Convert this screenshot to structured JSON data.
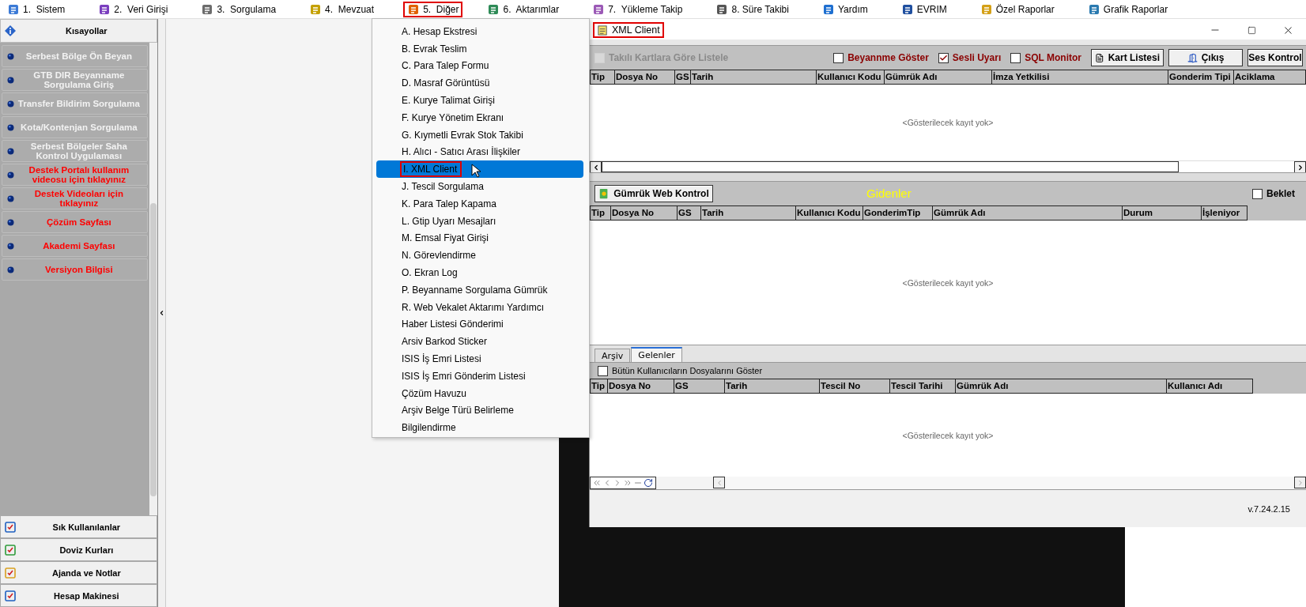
{
  "menu_bar": {
    "items": [
      {
        "label": "1.  Sistem",
        "selected": false
      },
      {
        "label": "2.  Veri Girişi",
        "selected": false
      },
      {
        "label": "3.  Sorgulama",
        "selected": false
      },
      {
        "label": "4.  Mevzuat",
        "selected": false
      },
      {
        "label": "5.  Diğer",
        "selected": true
      },
      {
        "label": "6.  Aktarımlar",
        "selected": false
      },
      {
        "label": "7.  Yükleme Takip",
        "selected": false
      },
      {
        "label": "8. Süre Takibi",
        "selected": false
      },
      {
        "label": "Yardım",
        "selected": false
      },
      {
        "label": "EVRIM",
        "selected": false
      },
      {
        "label": "Özel Raporlar",
        "selected": false
      },
      {
        "label": "Grafik Raporlar",
        "selected": false
      }
    ]
  },
  "sidebar": {
    "header": "Kısayollar",
    "items": [
      {
        "label": "Serbest Bölge Ön Beyan",
        "color": "#f2f2f2"
      },
      {
        "label": "GTB DIR Beyanname Sorgulama Giriş",
        "color": "#f2f2f2"
      },
      {
        "label": "Transfer Bildirim Sorgulama",
        "color": "#f2f2f2"
      },
      {
        "label": "Kota/Kontenjan Sorgulama",
        "color": "#f2f2f2"
      },
      {
        "label": "Serbest Bölgeler Saha Kontrol Uygulaması",
        "color": "#f2f2f2"
      },
      {
        "label": "Destek Portalı kullanım videosu için tıklayınız",
        "color": "#ff0000"
      },
      {
        "label": "Destek Videoları için tıklayınız",
        "color": "#ff0000"
      },
      {
        "label": "Çözüm Sayfası",
        "color": "#ff0000"
      },
      {
        "label": "Akademi Sayfası",
        "color": "#ff0000"
      },
      {
        "label": "Versiyon Bilgisi",
        "color": "#ff0000"
      }
    ],
    "bottom_buttons": [
      "Sık Kullanılanlar",
      "Doviz Kurları",
      "Ajanda ve Notlar",
      "Hesap Makinesi"
    ]
  },
  "dropdown_menu": {
    "items": [
      {
        "label": "A. Hesap Ekstresi",
        "selected": false
      },
      {
        "label": "B. Evrak Teslim",
        "selected": false
      },
      {
        "label": "C. Para Talep Formu",
        "selected": false
      },
      {
        "label": "D. Masraf Görüntüsü",
        "selected": false
      },
      {
        "label": "E. Kurye Talimat Girişi",
        "selected": false
      },
      {
        "label": "F. Kurye Yönetim Ekranı",
        "selected": false
      },
      {
        "label": "G. Kıymetli Evrak Stok Takibi",
        "selected": false
      },
      {
        "label": "H. Alıcı - Satıcı Arası İlişkiler",
        "selected": false
      },
      {
        "label": "I. XML Client",
        "selected": true
      },
      {
        "label": "J. Tescil Sorgulama",
        "selected": false
      },
      {
        "label": "K. Para Talep Kapama",
        "selected": false
      },
      {
        "label": "L. Gtip Uyarı Mesajları",
        "selected": false
      },
      {
        "label": "M. Emsal Fiyat Girişi",
        "selected": false
      },
      {
        "label": "N. Görevlendirme",
        "selected": false
      },
      {
        "label": "O. Ekran Log",
        "selected": false
      },
      {
        "label": "P. Beyanname Sorgulama Gümrük",
        "selected": false
      },
      {
        "label": "R. Web Vekalet Aktarımı Yardımcı",
        "selected": false
      },
      {
        "label": "Haber Listesi Gönderimi",
        "selected": false
      },
      {
        "label": "Arsiv Barkod Sticker",
        "selected": false
      },
      {
        "label": "ISIS İş Emri Listesi",
        "selected": false
      },
      {
        "label": "ISIS İş Emri Gönderim Listesi",
        "selected": false
      },
      {
        "label": "Çözüm Havuzu",
        "selected": false
      },
      {
        "label": "Arşiv Belge Türü Belirleme",
        "selected": false
      },
      {
        "label": "Bilgilendirme",
        "selected": false
      }
    ]
  },
  "window": {
    "title": "XML Client",
    "title_marked": true,
    "toolbar": {
      "checkboxes": [
        {
          "label": "Takılı Kartlara Göre Listele",
          "checked": false,
          "disabled": true
        },
        {
          "label": "Beyannme Göster",
          "checked": false,
          "disabled": false
        },
        {
          "label": "Sesli Uyarı",
          "checked": true,
          "disabled": false
        },
        {
          "label": "SQL Monitor",
          "checked": false,
          "disabled": false
        }
      ],
      "buttons": [
        "Kart Listesi",
        "Çıkış",
        "Ses Kontrol"
      ]
    },
    "top_table": {
      "columns": [
        "Tip",
        "Dosya No",
        "GS",
        "Tarih",
        "Kullanıcı Kodu",
        "Gümrük Adı",
        "İmza Yetkilisi",
        "Gonderim Tipi",
        "Aciklama"
      ],
      "empty_text": "<Gösterilecek kayıt yok>"
    },
    "outgoing": {
      "button": "Gümrük Web Kontrol",
      "title": "Gidenler",
      "checkbox": {
        "label": "Beklet",
        "checked": false
      },
      "columns": [
        "Tip",
        "Dosya No",
        "GS",
        "Tarih",
        "Kullanıcı Kodu",
        "GonderimTip",
        "Gümrük Adı",
        "Durum",
        "İşleniyor"
      ],
      "empty_text": "<Gösterilecek kayıt yok>"
    },
    "tabs": [
      {
        "label": "Arşiv",
        "selected": false
      },
      {
        "label": "Gelenler",
        "selected": true
      }
    ],
    "incoming": {
      "checkbox": {
        "label": "Bütün Kullanıcıların Dosyalarını Göster",
        "checked": false
      },
      "columns": [
        "Tip",
        "Dosya No",
        "GS",
        "Tarih",
        "Tescil No",
        "Tescil Tarihi",
        "Gümrük Adı",
        "Kullanıcı Adı"
      ],
      "empty_text": "<Gösterilecek kayıt yok>"
    },
    "status_bar": {
      "version": "v.7.24.2.15"
    }
  }
}
